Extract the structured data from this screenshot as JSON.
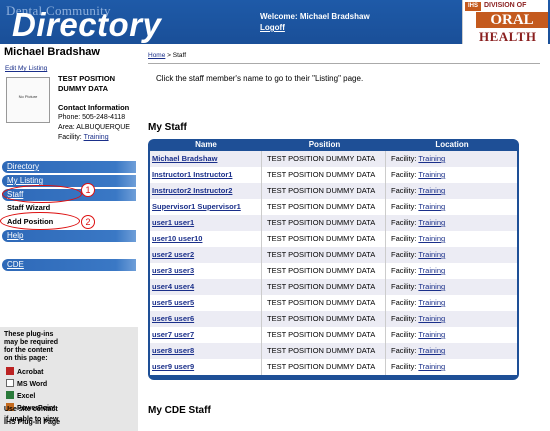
{
  "header": {
    "brand_small": "Dental Community",
    "brand_big": "Directory",
    "welcome": "Welcome: Michael Bradshaw",
    "logoff": "Logoff",
    "logo_ihs": "IHS",
    "logo_division": "DIVISION OF",
    "logo_oral": "ORAL",
    "logo_health": "HEALTH"
  },
  "sidebar": {
    "user_name": "Michael Bradshaw",
    "edit_link": "Edit My Listing",
    "photo_caption": "No Picture",
    "position_title_1": "TEST POSITION",
    "position_title_2": "DUMMY DATA",
    "contact_heading": "Contact Information",
    "phone": "Phone: 505-248-4118",
    "area": "Area: ALBUQUERQUE",
    "facility_label": "Facility:",
    "facility_link": "Training",
    "nav": {
      "directory": "Directory",
      "my_listing": "My Listing",
      "staff": "Staff",
      "staff_wizard": "Staff Wizard",
      "add_position": "Add Position",
      "help": "Help",
      "cde": "CDE"
    },
    "annotations": {
      "one": "1",
      "two": "2"
    },
    "plugins": {
      "text_1": "These plug-ins",
      "text_2": "may be required",
      "text_3": "for the content",
      "text_4": "on this page:",
      "acrobat": "Acrobat",
      "word": "MS Word",
      "excel": "Excel",
      "powerpoint": "PowerPoint",
      "ihs_plugin": "IHS Plug-in Page",
      "use_site_1": "Use site contact",
      "use_site_2": "if unable to view"
    }
  },
  "main": {
    "breadcrumb_home": "Home",
    "breadcrumb_sep": " > ",
    "breadcrumb_current": "Staff",
    "instructions": "Click the staff member's name to go to their \"Listing\" page.",
    "my_staff_heading": "My Staff",
    "my_cde_heading": "My CDE Staff",
    "table": {
      "headers": [
        "Name",
        "Position",
        "Location"
      ],
      "facility_label": "Facility:",
      "rows": [
        {
          "name": "Michael Bradshaw",
          "position": "TEST POSITION DUMMY DATA",
          "location": "Training"
        },
        {
          "name": "Instructor1 Instructor1",
          "position": "TEST POSITION DUMMY DATA",
          "location": "Training"
        },
        {
          "name": "Instructor2 Instructor2",
          "position": "TEST POSITION DUMMY DATA",
          "location": "Training"
        },
        {
          "name": "Supervisor1 Supervisor1",
          "position": "TEST POSITION DUMMY DATA",
          "location": "Training"
        },
        {
          "name": "user1 user1",
          "position": "TEST POSITION DUMMY DATA",
          "location": "Training"
        },
        {
          "name": "user10 user10",
          "position": "TEST POSITION DUMMY DATA",
          "location": "Training"
        },
        {
          "name": "user2 user2",
          "position": "TEST POSITION DUMMY DATA",
          "location": "Training"
        },
        {
          "name": "user3 user3",
          "position": "TEST POSITION DUMMY DATA",
          "location": "Training"
        },
        {
          "name": "user4 user4",
          "position": "TEST POSITION DUMMY DATA",
          "location": "Training"
        },
        {
          "name": "user5 user5",
          "position": "TEST POSITION DUMMY DATA",
          "location": "Training"
        },
        {
          "name": "user6 user6",
          "position": "TEST POSITION DUMMY DATA",
          "location": "Training"
        },
        {
          "name": "user7 user7",
          "position": "TEST POSITION DUMMY DATA",
          "location": "Training"
        },
        {
          "name": "user8 user8",
          "position": "TEST POSITION DUMMY DATA",
          "location": "Training"
        },
        {
          "name": "user9 user9",
          "position": "TEST POSITION DUMMY DATA",
          "location": "Training"
        }
      ]
    }
  },
  "colors": {
    "header_blue": "#1e5aa8",
    "nav_blue": "#3a78c5",
    "table_blue": "#1e4f96",
    "annotation_red": "#d11",
    "logo_orange": "#c45a1e"
  }
}
